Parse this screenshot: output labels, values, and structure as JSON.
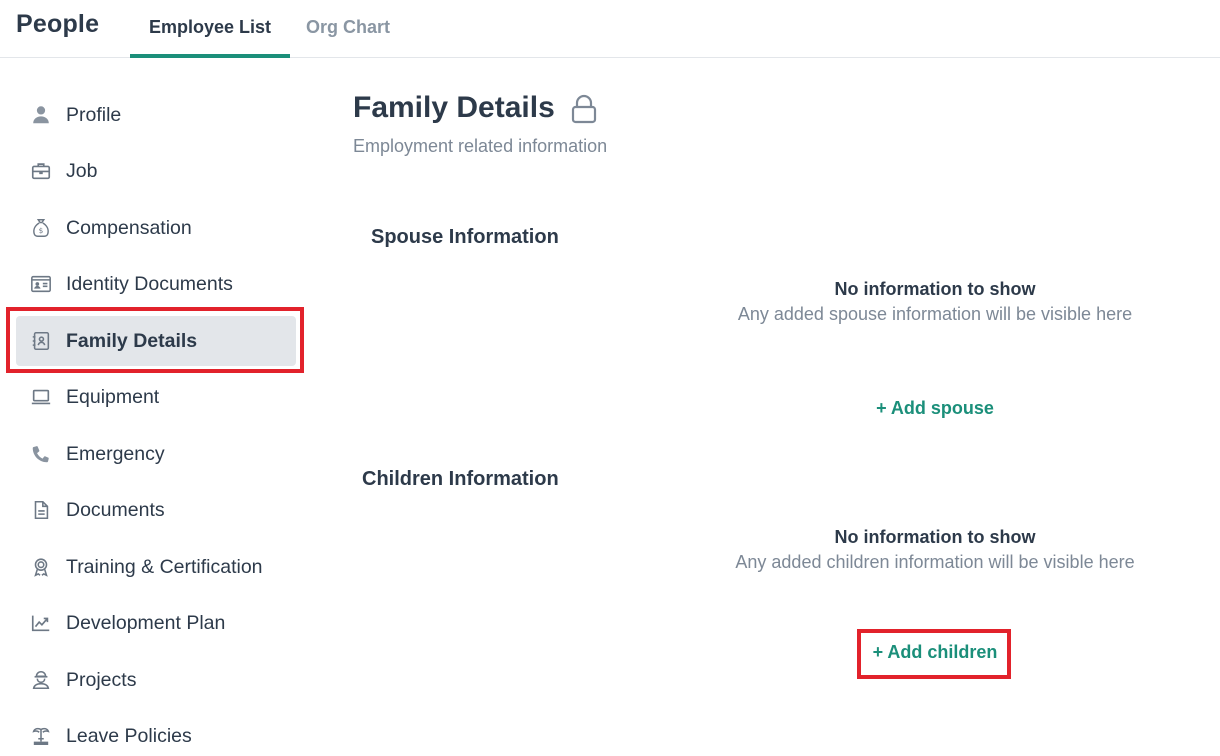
{
  "header": {
    "app_title": "People",
    "tabs": [
      {
        "label": "Employee List",
        "active": true
      },
      {
        "label": "Org Chart",
        "active": false
      }
    ]
  },
  "sidebar": {
    "items": [
      {
        "label": "Profile",
        "icon": "person-icon"
      },
      {
        "label": "Job",
        "icon": "briefcase-icon"
      },
      {
        "label": "Compensation",
        "icon": "money-bag-icon"
      },
      {
        "label": "Identity Documents",
        "icon": "id-card-icon"
      },
      {
        "label": "Family Details",
        "icon": "contact-book-icon",
        "active": true
      },
      {
        "label": "Equipment",
        "icon": "laptop-icon"
      },
      {
        "label": "Emergency",
        "icon": "phone-icon"
      },
      {
        "label": "Documents",
        "icon": "document-icon"
      },
      {
        "label": "Training & Certification",
        "icon": "award-icon"
      },
      {
        "label": "Development Plan",
        "icon": "trend-chart-icon"
      },
      {
        "label": "Projects",
        "icon": "worker-icon"
      },
      {
        "label": "Leave Policies",
        "icon": "beach-icon"
      }
    ]
  },
  "main": {
    "title": "Family Details",
    "subtitle": "Employment related information",
    "spouse": {
      "title": "Spouse Information",
      "empty_title": "No information to show",
      "empty_desc": "Any added spouse information will be visible here",
      "add_label": "+ Add spouse"
    },
    "children": {
      "title": "Children Information",
      "empty_title": "No information to show",
      "empty_desc": "Any added children information will be visible here",
      "add_label": "+ Add children"
    }
  },
  "colors": {
    "accent": "#1b8f7a",
    "highlight": "#e2222b",
    "text": "#2d3a4a",
    "muted": "#7d8896",
    "active_bg": "#e3e6ea"
  }
}
